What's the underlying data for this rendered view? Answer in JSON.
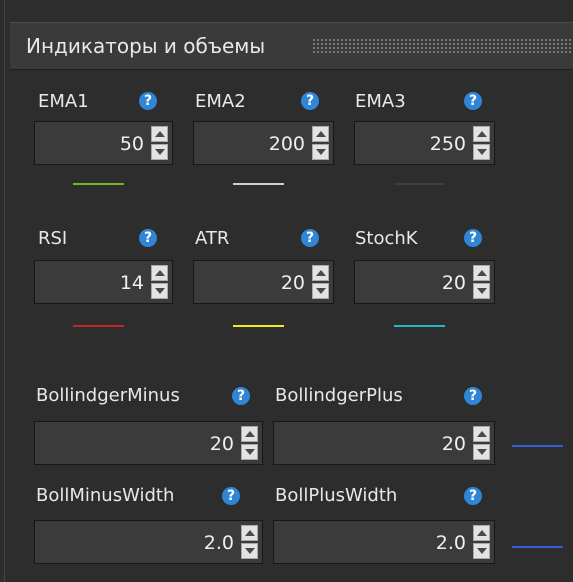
{
  "header": {
    "title": "Индикаторы и объемы"
  },
  "ema": [
    {
      "label": "EMA1",
      "value": "50",
      "line_color": "#6fb81f"
    },
    {
      "label": "EMA2",
      "value": "200",
      "line_color": "#cfcfcf"
    },
    {
      "label": "EMA3",
      "value": "250",
      "line_color": "#3d3d3d"
    }
  ],
  "osc": [
    {
      "label": "RSI",
      "value": "14",
      "line_color": "#c0282a"
    },
    {
      "label": "ATR",
      "value": "20",
      "line_color": "#f3ea1d"
    },
    {
      "label": "StochK",
      "value": "20",
      "line_color": "#28b6c8"
    }
  ],
  "boll": [
    {
      "label": "BollindgerMinus",
      "value": "20"
    },
    {
      "label": "BollindgerPlus",
      "value": "20",
      "line_color": "#2f5ed6"
    }
  ],
  "bollw": [
    {
      "label": "BollMinusWidth",
      "value": "2.0"
    },
    {
      "label": "BollPlusWidth",
      "value": "2.0",
      "line_color": "#2f5ed6"
    }
  ],
  "help_icon": "?"
}
